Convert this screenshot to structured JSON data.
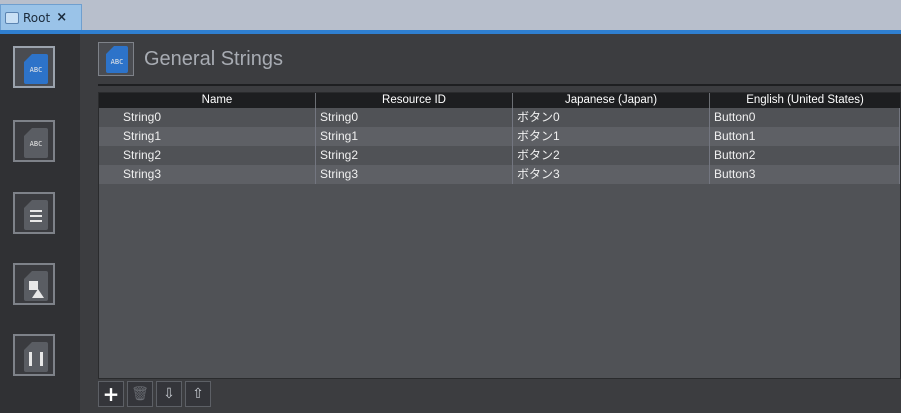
{
  "tab": {
    "label": "Root",
    "close": "×"
  },
  "sidebar": {
    "items": [
      {
        "name": "general-strings",
        "glyph": "ABC",
        "active": true
      },
      {
        "name": "audio-strings",
        "glyph": "ABC",
        "active": false
      },
      {
        "name": "list",
        "glyph": "",
        "active": false
      },
      {
        "name": "images",
        "glyph": "",
        "active": false
      },
      {
        "name": "movies",
        "glyph": "",
        "active": false
      }
    ]
  },
  "header": {
    "title": "General Strings",
    "icon_glyph": "ABC"
  },
  "table": {
    "columns": [
      "Name",
      "Resource ID",
      "Japanese (Japan)",
      "English (United States)"
    ],
    "rows": [
      [
        "String0",
        "String0",
        "ボタン0",
        "Button0"
      ],
      [
        "String1",
        "String1",
        "ボタン1",
        "Button1"
      ],
      [
        "String2",
        "String2",
        "ボタン2",
        "Button2"
      ],
      [
        "String3",
        "String3",
        "ボタン3",
        "Button3"
      ]
    ]
  },
  "toolbar": {
    "add": "+",
    "delete": "🗑",
    "import": "⇩",
    "export": "⇧"
  },
  "colors": {
    "accent": "#2f7fd0",
    "active_icon": "#2d73c9"
  }
}
